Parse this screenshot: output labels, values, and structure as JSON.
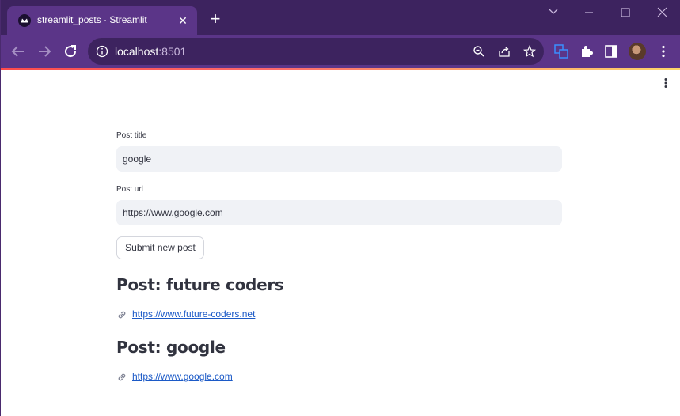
{
  "browser": {
    "tab_title": "streamlit_posts · Streamlit",
    "url_host": "localhost",
    "url_port": ":8501"
  },
  "form": {
    "title_label": "Post title",
    "title_value": "google",
    "url_label": "Post url",
    "url_value": "https://www.google.com",
    "submit_label": "Submit new post"
  },
  "posts": [
    {
      "heading": "Post: future coders",
      "url": "https://www.future-coders.net"
    },
    {
      "heading": "Post: google",
      "url": "https://www.google.com"
    }
  ],
  "colors": {
    "browser_frame": "#3d235f",
    "toolbar": "#5b3588",
    "input_bg": "#f0f2f6",
    "link": "#1c5ac7"
  }
}
